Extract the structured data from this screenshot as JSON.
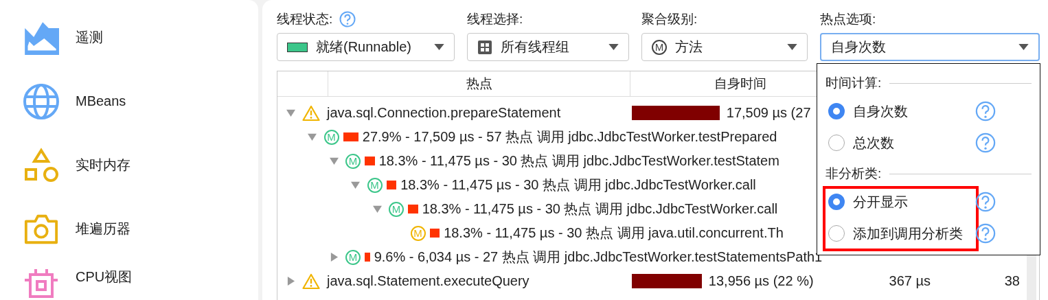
{
  "sidebar": {
    "items": [
      {
        "label": "遥测"
      },
      {
        "label": "MBeans"
      },
      {
        "label": "实时内存"
      },
      {
        "label": "堆遍历器"
      },
      {
        "label": "CPU视图"
      }
    ]
  },
  "filters": [
    {
      "label": "线程状态:",
      "help": true,
      "value": "就绪(Runnable)",
      "kind": "swatch",
      "color": "#3cc68a",
      "focused": false
    },
    {
      "label": "线程选择:",
      "help": false,
      "value": "所有线程组",
      "kind": "grid",
      "focused": false
    },
    {
      "label": "聚合级别:",
      "help": false,
      "value": "方法",
      "kind": "letter",
      "letter": "M",
      "focused": false
    },
    {
      "label": "热点选项:",
      "help": false,
      "value": "自身次数",
      "kind": "plain",
      "focused": true
    }
  ],
  "table": {
    "columns": [
      "热点",
      "自身时间"
    ],
    "rows": [
      {
        "kind": "hotspot",
        "expandable": true,
        "expanded": true,
        "name": "java.sql.Connection.prepareStatement",
        "self_time": "17,509 µs (27",
        "children": [
          {
            "kind": "call",
            "letter": "M",
            "color": "#3cc68a",
            "expandable": true,
            "expanded": true,
            "text": "27.9% - 17,509 µs - 57 热点 调用 jdbc.JdbcTestWorker.testPrepared",
            "children": [
              {
                "kind": "call",
                "letter": "M",
                "color": "#3cc68a",
                "expandable": true,
                "expanded": true,
                "text": "18.3% - 11,475 µs - 30 热点 调用 jdbc.JdbcTestWorker.testStatem",
                "children": [
                  {
                    "kind": "call",
                    "letter": "M",
                    "color": "#3cc68a",
                    "expandable": true,
                    "expanded": true,
                    "text": "18.3% - 11,475 µs - 30 热点 调用 jdbc.JdbcTestWorker.call",
                    "children": [
                      {
                        "kind": "call",
                        "letter": "M",
                        "color": "#3cc68a",
                        "expandable": true,
                        "expanded": true,
                        "text": "18.3% - 11,475 µs - 30 热点 调用 jdbc.JdbcTestWorker.call",
                        "children": [
                          {
                            "kind": "call",
                            "letter": "M",
                            "color": "#f0b400",
                            "expandable": false,
                            "text": "18.3% - 11,475 µs - 30 热点 调用 java.util.concurrent.Th"
                          }
                        ]
                      }
                    ]
                  }
                ]
              },
              {
                "kind": "call",
                "letter": "M",
                "color": "#3cc68a",
                "expandable": true,
                "expanded": false,
                "text": "9.6% - 6,034 µs - 27 热点 调用 jdbc.JdbcTestWorker.testStatementsPath1"
              }
            ]
          }
        ]
      },
      {
        "kind": "hotspot",
        "expandable": true,
        "expanded": false,
        "name": "java.sql.Statement.executeQuery",
        "self_time": "13,956 µs (22 %)",
        "column_3": "367 µs",
        "column_4": "38"
      }
    ]
  },
  "popup": {
    "sections": [
      {
        "title": "时间计算:",
        "highlighted": false,
        "options": [
          {
            "label": "自身次数",
            "selected": true,
            "help": true
          },
          {
            "label": "总次数",
            "selected": false,
            "help": true
          }
        ]
      },
      {
        "title": "非分析类:",
        "highlighted": true,
        "options": [
          {
            "label": "分开显示",
            "selected": true,
            "help": true
          },
          {
            "label": "添加到调用分析类",
            "selected": false,
            "help": true
          }
        ]
      }
    ]
  }
}
